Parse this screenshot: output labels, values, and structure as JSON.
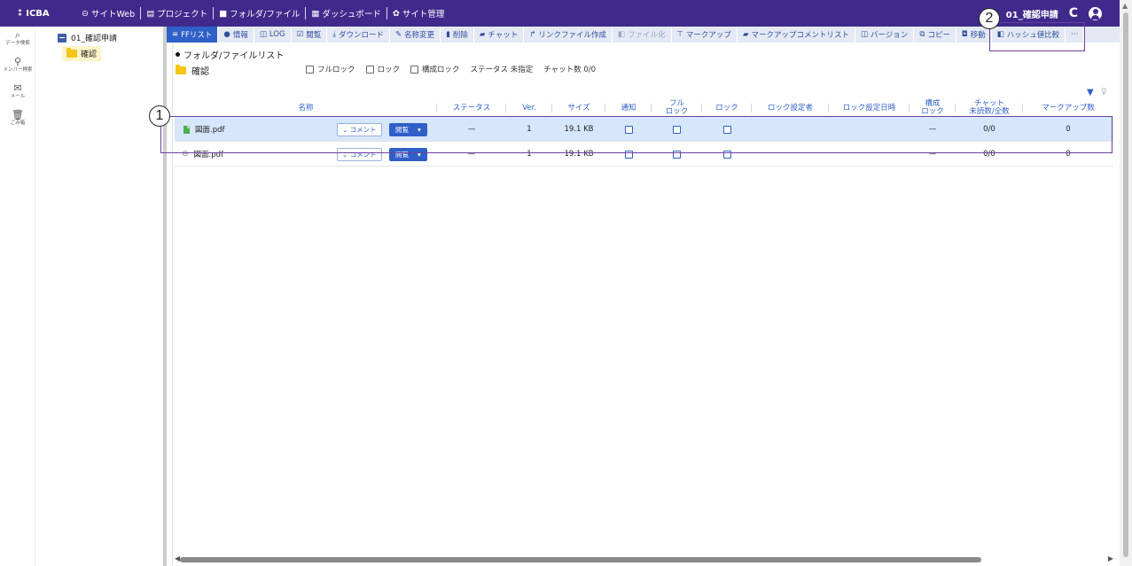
{
  "topbar": {
    "app_name": "ICBA",
    "nav": [
      {
        "icon": "⊝",
        "label": "サイトWeb"
      },
      {
        "icon": "▤",
        "label": "プロジェクト"
      },
      {
        "icon": "■",
        "label": "フォルダ/ファイル"
      },
      {
        "icon": "▦",
        "label": "ダッシュボード"
      },
      {
        "icon": "✿",
        "label": "サイト管理"
      }
    ],
    "project": "01_確認申請",
    "bg_color": "#3f2a8c"
  },
  "rail": [
    {
      "icon": "⌕",
      "label": "データ検索"
    },
    {
      "icon": "⚲",
      "label": "メンバー検索"
    },
    {
      "icon": "✉",
      "label": "メール"
    },
    {
      "icon": "🗑",
      "label": "ごみ箱"
    }
  ],
  "tree": {
    "root": "01_確認申請",
    "child": "確認"
  },
  "toolbar": [
    {
      "icon": "≡",
      "label": "FFリスト"
    },
    {
      "icon": "●",
      "label": "情報"
    },
    {
      "icon": "◫",
      "label": "LOG"
    },
    {
      "icon": "☑",
      "label": "閲覧"
    },
    {
      "icon": "⤓",
      "label": "ダウンロード"
    },
    {
      "icon": "✎",
      "label": "名称変更"
    },
    {
      "icon": "▮",
      "label": "削除"
    },
    {
      "icon": "▰",
      "label": "チャット"
    },
    {
      "icon": "↱",
      "label": "リンクファイル作成"
    },
    {
      "icon": "◧",
      "label": "ファイル化"
    },
    {
      "icon": "⊤",
      "label": "マークアップ"
    },
    {
      "icon": "▰",
      "label": "マークアップコメントリスト"
    },
    {
      "icon": "◫",
      "label": "バージョン"
    },
    {
      "icon": "⧉",
      "label": "コピー"
    },
    {
      "icon": "◘",
      "label": "移動"
    },
    {
      "icon": "◧",
      "label": "ハッシュ値比較"
    },
    {
      "icon": "",
      "label": "···"
    }
  ],
  "list_title": "フォルダ/ファイルリスト",
  "folder": {
    "name": "確認",
    "flags": [
      "フルロック",
      "ロック",
      "構成ロック"
    ],
    "status": "ステータス 未指定",
    "chat": "チャット数 0/0"
  },
  "table": {
    "columns": [
      "名称",
      "ステータス",
      "Ver.",
      "サイズ",
      "通知",
      "フル\nロック",
      "ロック",
      "ロック設定者",
      "ロック設定日時",
      "構成\nロック",
      "チャット\n未読数/全数",
      "マークアップ数"
    ],
    "rows": [
      {
        "name": "図面.pdf",
        "comment": "コメント",
        "open": "閲覧",
        "status": "—",
        "ver": "1",
        "size": "19.1 KB",
        "config_lock": "—",
        "chat": "0/0",
        "markup": "0",
        "type": "pdf"
      },
      {
        "name": "図面.pdf",
        "comment": "コメント",
        "open": "閲覧",
        "status": "—",
        "ver": "1",
        "size": "19.1 KB",
        "config_lock": "—",
        "chat": "0/0",
        "markup": "0",
        "type": "link"
      }
    ]
  },
  "annotations": [
    "1",
    "2"
  ]
}
